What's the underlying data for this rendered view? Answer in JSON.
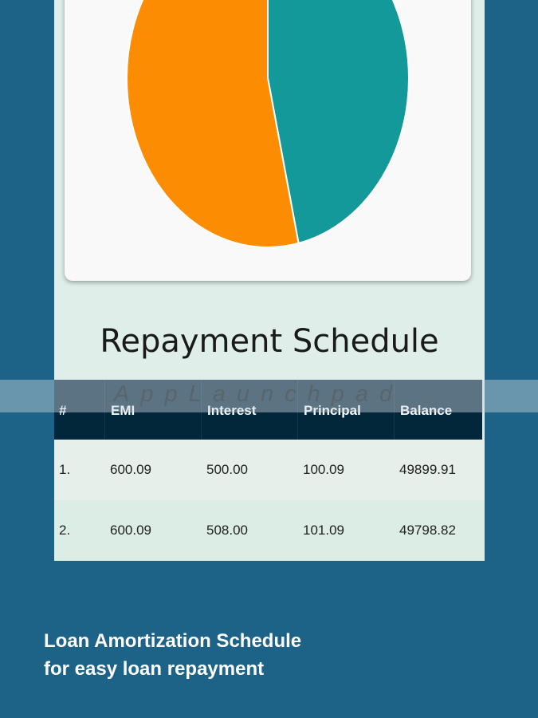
{
  "chart_data": {
    "type": "pie",
    "slices": [
      {
        "value": 53.5,
        "color": "#fc8c02"
      },
      {
        "value": 46.5,
        "color": "#14999b"
      }
    ]
  },
  "schedule": {
    "title": "Repayment Schedule",
    "columns": [
      "#",
      "EMI",
      "Interest",
      "Principal",
      "Balance"
    ],
    "rows": [
      {
        "num": "1.",
        "emi": "600.09",
        "interest": "500.00",
        "principal": "100.09",
        "balance": "49899.91"
      },
      {
        "num": "2.",
        "emi": "600.09",
        "interest": "508.00",
        "principal": "101.09",
        "balance": "49798.82"
      }
    ]
  },
  "watermark": "AppLaunchpad",
  "caption": {
    "line1": "Loan Amortization Schedule",
    "line2": "for easy loan repayment"
  },
  "colors": {
    "background": "#1d6388",
    "header_bg": "#02263a",
    "panel_bg": "#dfeee8"
  }
}
